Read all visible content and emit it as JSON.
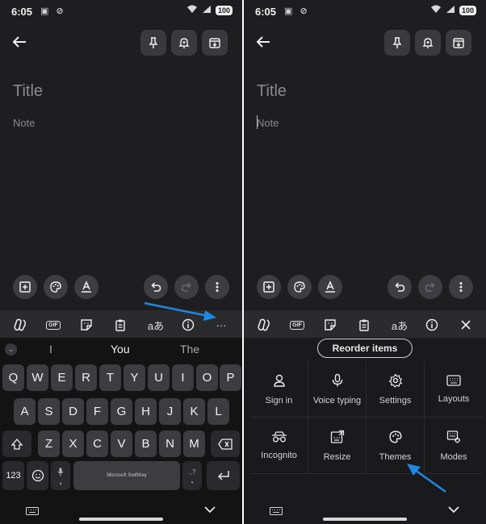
{
  "status": {
    "time": "6:05",
    "battery": "100"
  },
  "note": {
    "title_placeholder": "Title",
    "body_placeholder": "Note"
  },
  "keyboard": {
    "suggestions": [
      "I",
      "You",
      "The"
    ],
    "row1": [
      "Q",
      "W",
      "E",
      "R",
      "T",
      "Y",
      "U",
      "I",
      "O",
      "P"
    ],
    "row2": [
      "A",
      "S",
      "D",
      "F",
      "G",
      "H",
      "J",
      "K",
      "L"
    ],
    "row3": [
      "Z",
      "X",
      "C",
      "V",
      "B",
      "N",
      "M"
    ],
    "num_key": "123",
    "comma": ",",
    "period": ".",
    "period_alt": ".,?",
    "spacebar": "Microsoft SwiftKey",
    "gif": "GIF",
    "translate": "aあ",
    "more": "···"
  },
  "menu": {
    "reorder_label": "Reorder items",
    "items": [
      {
        "label": "Sign in",
        "icon": "person-icon"
      },
      {
        "label": "Voice typing",
        "icon": "microphone-icon"
      },
      {
        "label": "Settings",
        "icon": "gear-icon"
      },
      {
        "label": "Layouts",
        "icon": "keyboard-icon"
      },
      {
        "label": "Incognito",
        "icon": "incognito-icon"
      },
      {
        "label": "Resize",
        "icon": "resize-icon"
      },
      {
        "label": "Themes",
        "icon": "palette-icon"
      },
      {
        "label": "Modes",
        "icon": "modes-icon"
      }
    ]
  },
  "colors": {
    "panel": "#1e1e20",
    "key": "#3d3d40",
    "arrow": "#1e88e5"
  }
}
